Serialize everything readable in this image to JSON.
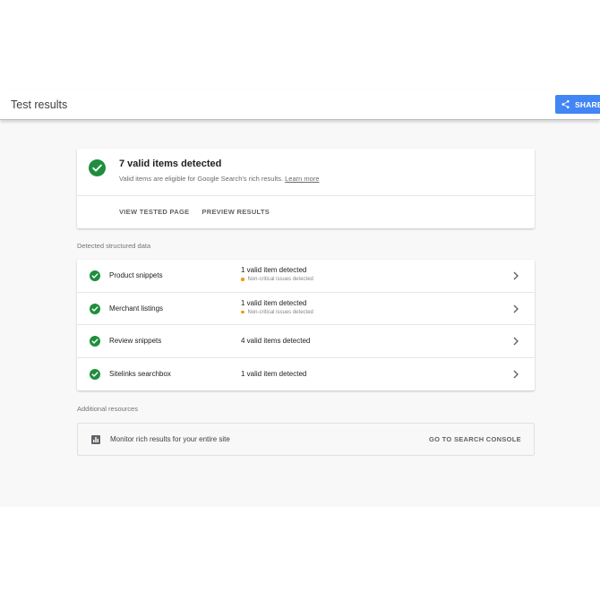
{
  "header": {
    "title": "Test results",
    "share_label": "SHARE"
  },
  "summary": {
    "title": "7 valid items detected",
    "subtitle": "Valid items are eligible for Google Search's rich results.",
    "learn_more": "Learn more",
    "actions": {
      "view_tested_page": "VIEW TESTED PAGE",
      "preview_results": "PREVIEW RESULTS"
    }
  },
  "detected": {
    "label": "Detected structured data",
    "items": [
      {
        "name": "Product snippets",
        "status": "1 valid item detected",
        "warning": "Non-critical issues detected"
      },
      {
        "name": "Merchant listings",
        "status": "1 valid item detected",
        "warning": "Non-critical issues detected"
      },
      {
        "name": "Review snippets",
        "status": "4 valid items detected"
      },
      {
        "name": "Sitelinks searchbox",
        "status": "1 valid item detected"
      }
    ]
  },
  "additional": {
    "label": "Additional resources",
    "resource_text": "Monitor rich results for your entire site",
    "resource_link": "GO TO SEARCH CONSOLE"
  },
  "colors": {
    "success_green": "#1e8e3e",
    "share_blue": "#4285f4",
    "warning_orange": "#f29900"
  },
  "icons": {
    "share": "share-icon",
    "summary": "check-circle-icon",
    "row": "check-circle-icon",
    "chevron": "chevron-right-icon",
    "resource": "bar-chart-icon"
  }
}
